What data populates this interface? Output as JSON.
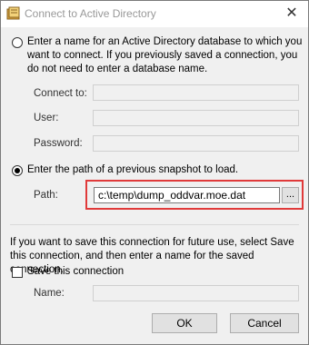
{
  "window": {
    "title": "Connect to Active Directory",
    "close_glyph": "✕"
  },
  "option_database": {
    "selected": false,
    "text": "Enter a name for an Active Directory database to which you want to connect. If you previously saved a connection, you do not need to enter a database name.",
    "lines": [
      "Enter a name for an Active Directory database to which you",
      "want to connect. If you previously saved a connection, you",
      "do not need to enter a database name."
    ],
    "connect_to_label": "Connect to:",
    "connect_to_value": "",
    "user_label": "User:",
    "user_value": "",
    "password_label": "Password:",
    "password_value": ""
  },
  "option_snapshot": {
    "selected": true,
    "text": "Enter the path of a previous snapshot to load.",
    "path_label": "Path:",
    "path_value": "c:\\temp\\dump_oddvar.moe.dat",
    "browse_label": "..."
  },
  "save_section": {
    "lines": [
      "If you want to save this connection for future use, select Save",
      "this connection, and then enter a name for the saved connection."
    ],
    "checkbox_label": "Save this connection",
    "checked": false,
    "name_label": "Name:",
    "name_value": ""
  },
  "buttons": {
    "ok": "OK",
    "cancel": "Cancel"
  },
  "icons": {
    "app": "address-book-icon",
    "close": "close-icon"
  },
  "colors": {
    "highlight": "#e03a3a",
    "dialog_bg": "#f0f0f0"
  }
}
